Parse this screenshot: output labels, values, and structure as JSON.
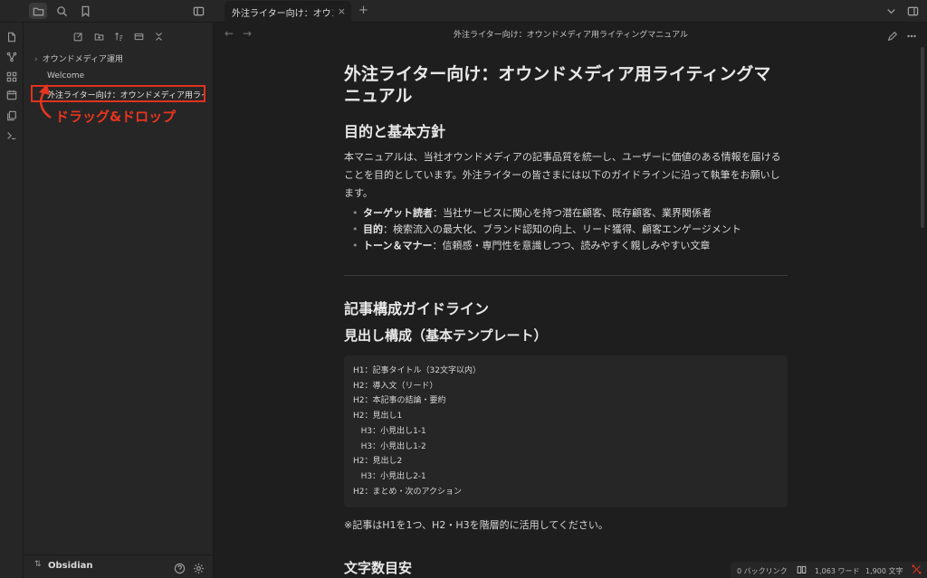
{
  "tab": {
    "title": "外注ライター向け：オウンドメディア用ライティングマニュアル",
    "close": "×",
    "new": "+"
  },
  "sidebar": {
    "folder": "オウンドメディア運用",
    "folder_chevron": "›",
    "items": [
      "Welcome",
      "外注ライター向け：オウンドメディア用ライティングマニュアル"
    ],
    "annotation": "ドラッグ&ドロップ",
    "vault": "Obsidian",
    "vault_chevron": "⇅"
  },
  "view": {
    "title": "外注ライター向け：オウンドメディア用ライティングマニュアル",
    "back": "←",
    "forward": "→"
  },
  "doc": {
    "title": "外注ライター向け：オウンドメディア用ライティングマニュアル",
    "h2_purpose": "目的と基本方針",
    "intro": "本マニュアルは、当社オウンドメディアの記事品質を統一し、ユーザーに価値のある情報を届けることを目的としています。外注ライターの皆さまには以下のガイドラインに沿って執筆をお願いします。",
    "bullets": [
      {
        "label": "ターゲット読者",
        "text": "：当社サービスに関心を持つ潜在顧客、既存顧客、業界関係者"
      },
      {
        "label": "目的",
        "text": "：検索流入の最大化、ブランド認知の向上、リード獲得、顧客エンゲージメント"
      },
      {
        "label": "トーン＆マナー",
        "text": "：信頼感・専門性を意識しつつ、読みやすく親しみやすい文章"
      }
    ],
    "h2_structure": "記事構成ガイドライン",
    "h3_template": "見出し構成（基本テンプレート）",
    "code_lines": [
      "H1：記事タイトル（32文字以内）",
      "H2：導入文（リード）",
      "H2：本記事の結論・要約",
      "H2：見出し1",
      "   H3：小見出し1-1",
      "   H3：小見出し1-2",
      "H2：見出し2",
      "   H3：小見出し2-1",
      "H2：まとめ・次のアクション"
    ],
    "note": "※記事はH1を1つ、H2・H3を階層的に活用してください。",
    "h2_wordcount": "文字数目安"
  },
  "status": {
    "backlinks": "0 バックリンク",
    "words": "1,063 ワード",
    "chars": "1,900 文字"
  },
  "colors": {
    "background": "#1e1e1e",
    "panel": "#262626",
    "annotation": "#e8351f"
  }
}
